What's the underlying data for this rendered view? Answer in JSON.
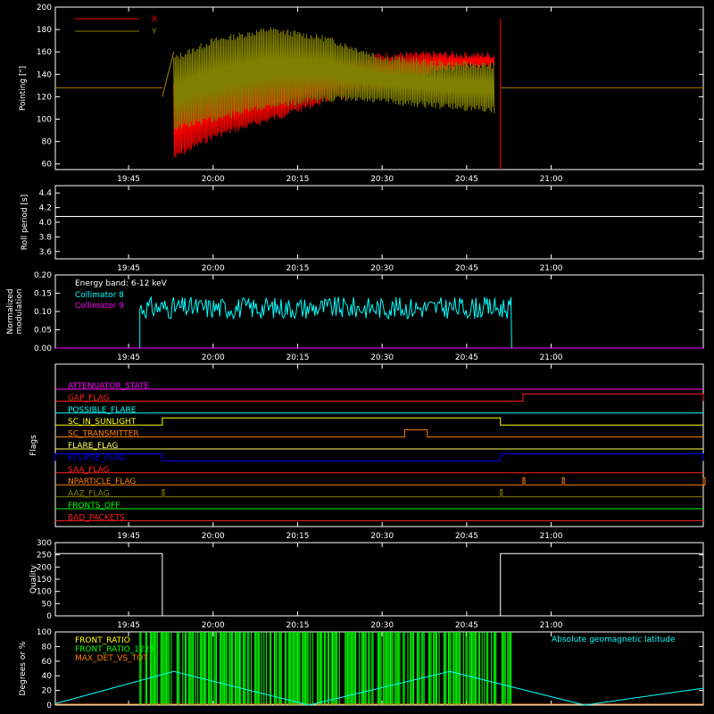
{
  "time_ticks": [
    "19:45",
    "20:00",
    "20:15",
    "20:30",
    "20:45",
    "21:00"
  ],
  "panels": {
    "pointing": {
      "ylabel": "Pointing [\"]",
      "yticks": [
        "60",
        "80",
        "100",
        "120",
        "140",
        "160",
        "180",
        "200"
      ],
      "legend": [
        {
          "name": "X",
          "color": "#ff0000"
        },
        {
          "name": "Y",
          "color": "#808000"
        }
      ]
    },
    "roll": {
      "ylabel": "Roll period [s]",
      "yticks": [
        "3.6",
        "3.8",
        "4.0",
        "4.2",
        "4.4"
      ]
    },
    "modulation": {
      "ylabel_line1": "Normalized",
      "ylabel_line2": "modulation",
      "yticks": [
        "0.00",
        "0.05",
        "0.10",
        "0.15",
        "0.20"
      ],
      "energy_label": "Energy band: 6-12 keV",
      "legend": [
        {
          "name": "Collimator 8",
          "color": "#00ffff"
        },
        {
          "name": "Collimator 9",
          "color": "#ff00ff"
        }
      ]
    },
    "flags": {
      "ylabel": "Flags",
      "items": [
        {
          "name": "ATTENUATOR_STATE",
          "color": "#ff00ff"
        },
        {
          "name": "GAP_FLAG",
          "color": "#ff2020"
        },
        {
          "name": "POSSIBLE_FLARE",
          "color": "#00ffff"
        },
        {
          "name": "SC_IN_SUNLIGHT",
          "color": "#ffff00"
        },
        {
          "name": "SC_TRANSMITTER",
          "color": "#ff8000"
        },
        {
          "name": "FLARE_FLAG",
          "color": "#ffff60"
        },
        {
          "name": "ECLIPSE_FLAG",
          "color": "#0000ff"
        },
        {
          "name": "SAA_FLAG",
          "color": "#ff2020"
        },
        {
          "name": "NPARTICLE_FLAG",
          "color": "#ff8000"
        },
        {
          "name": "AAZ_FLAG",
          "color": "#808000"
        },
        {
          "name": "FRONTS_OFF",
          "color": "#00ff00"
        },
        {
          "name": "BAD_PACKETS",
          "color": "#ff2020"
        }
      ]
    },
    "quality": {
      "ylabel": "Quality",
      "yticks": [
        "0",
        "50",
        "100",
        "150",
        "200",
        "250",
        "300"
      ]
    },
    "ratio": {
      "ylabel": "Degrees or %",
      "yticks": [
        "0",
        "20",
        "40",
        "60",
        "80",
        "100"
      ],
      "legend": [
        {
          "name": "FRONT_RATIO",
          "color": "#ffff00"
        },
        {
          "name": "FRONT_RATIO_1225",
          "color": "#00ff00"
        },
        {
          "name": "MAX_DET_VS_TOT",
          "color": "#ff8000"
        }
      ],
      "right_label": "Absolute geomagnetic latitude",
      "right_label_color": "#00ffff"
    }
  },
  "chart_data": [
    {
      "type": "line",
      "title": "",
      "ylabel": "Pointing [\"]",
      "ylim": [
        55,
        200
      ],
      "xlim": [
        "19:32",
        "21:27"
      ],
      "series": [
        {
          "name": "X",
          "x": [
            "19:32",
            "19:51",
            "19:53",
            "20:00",
            "20:10",
            "20:20",
            "20:30",
            "20:40",
            "20:50",
            "20:51",
            "21:27"
          ],
          "upper": [
            128,
            128,
            132,
            134,
            138,
            150,
            157,
            158,
            157,
            null,
            128
          ],
          "lower": [
            128,
            128,
            66,
            85,
            100,
            117,
            128,
            145,
            148,
            null,
            128
          ]
        },
        {
          "name": "Y",
          "x": [
            "19:32",
            "19:51",
            "19:53",
            "20:00",
            "20:10",
            "20:20",
            "20:30",
            "20:40",
            "20:50",
            "20:51",
            "21:27"
          ],
          "upper": [
            128,
            128,
            154,
            170,
            180,
            172,
            155,
            150,
            148,
            null,
            128
          ],
          "lower": [
            128,
            128,
            92,
            100,
            112,
            118,
            116,
            112,
            108,
            null,
            128
          ]
        }
      ]
    },
    {
      "type": "line",
      "title": "",
      "ylabel": "Roll period [s]",
      "ylim": [
        3.5,
        4.5
      ],
      "series": [
        {
          "name": "",
          "x": [
            "19:32",
            "21:27"
          ],
          "y": [
            4.08,
            4.08
          ]
        }
      ]
    },
    {
      "type": "line",
      "title": "Energy band: 6-12 keV",
      "ylabel": "Normalized modulation",
      "ylim": [
        0,
        0.2
      ],
      "series": [
        {
          "name": "Collimator 8",
          "x": [
            "19:47",
            "20:53"
          ],
          "y_mean": 0.11,
          "y_min": 0.08,
          "y_max": 0.14
        },
        {
          "name": "Collimator 9",
          "x": [
            "19:32",
            "21:27"
          ],
          "y": [
            0,
            0
          ]
        }
      ]
    },
    {
      "type": "line",
      "title": "",
      "ylabel": "Flags",
      "series": [
        {
          "name": "ATTENUATOR_STATE",
          "segments": []
        },
        {
          "name": "GAP_FLAG",
          "segments": [
            [
              "20:55",
              "21:27"
            ]
          ]
        },
        {
          "name": "POSSIBLE_FLARE",
          "segments": []
        },
        {
          "name": "SC_IN_SUNLIGHT",
          "segments": [
            [
              "19:51",
              "20:51"
            ]
          ]
        },
        {
          "name": "SC_TRANSMITTER",
          "segments": [
            [
              "20:34",
              "20:38"
            ]
          ]
        },
        {
          "name": "FLARE_FLAG",
          "segments": []
        },
        {
          "name": "ECLIPSE_FLAG",
          "segments": [
            [
              "19:32",
              "19:51"
            ],
            [
              "20:51",
              "21:27"
            ]
          ]
        },
        {
          "name": "SAA_FLAG",
          "segments": []
        },
        {
          "name": "NPARTICLE_FLAG",
          "segments": [
            [
              "20:55",
              "20:55"
            ],
            [
              "21:02",
              "21:02"
            ],
            [
              "21:27",
              "21:27"
            ]
          ]
        },
        {
          "name": "AAZ_FLAG",
          "segments": [
            [
              "19:51",
              "19:51"
            ],
            [
              "20:51",
              "20:51"
            ]
          ]
        },
        {
          "name": "FRONTS_OFF",
          "segments": []
        },
        {
          "name": "BAD_PACKETS",
          "segments": []
        }
      ]
    },
    {
      "type": "line",
      "title": "",
      "ylabel": "Quality",
      "ylim": [
        0,
        300
      ],
      "series": [
        {
          "name": "",
          "x": [
            "19:32",
            "19:51",
            "19:51",
            "20:51",
            "20:51",
            "21:27"
          ],
          "y": [
            255,
            255,
            0,
            0,
            255,
            255
          ]
        }
      ]
    },
    {
      "type": "line",
      "title": "",
      "ylabel": "Degrees or %",
      "ylim": [
        0,
        100
      ],
      "series": [
        {
          "name": "FRONT_RATIO_1225",
          "x": [
            "19:47",
            "20:53"
          ],
          "y": [
            100,
            100
          ]
        },
        {
          "name": "Absolute geomagnetic latitude",
          "x": [
            "19:32",
            "19:53",
            "20:17",
            "20:42",
            "21:06",
            "21:27"
          ],
          "y": [
            2,
            46,
            0,
            46,
            0,
            23
          ]
        }
      ]
    }
  ]
}
